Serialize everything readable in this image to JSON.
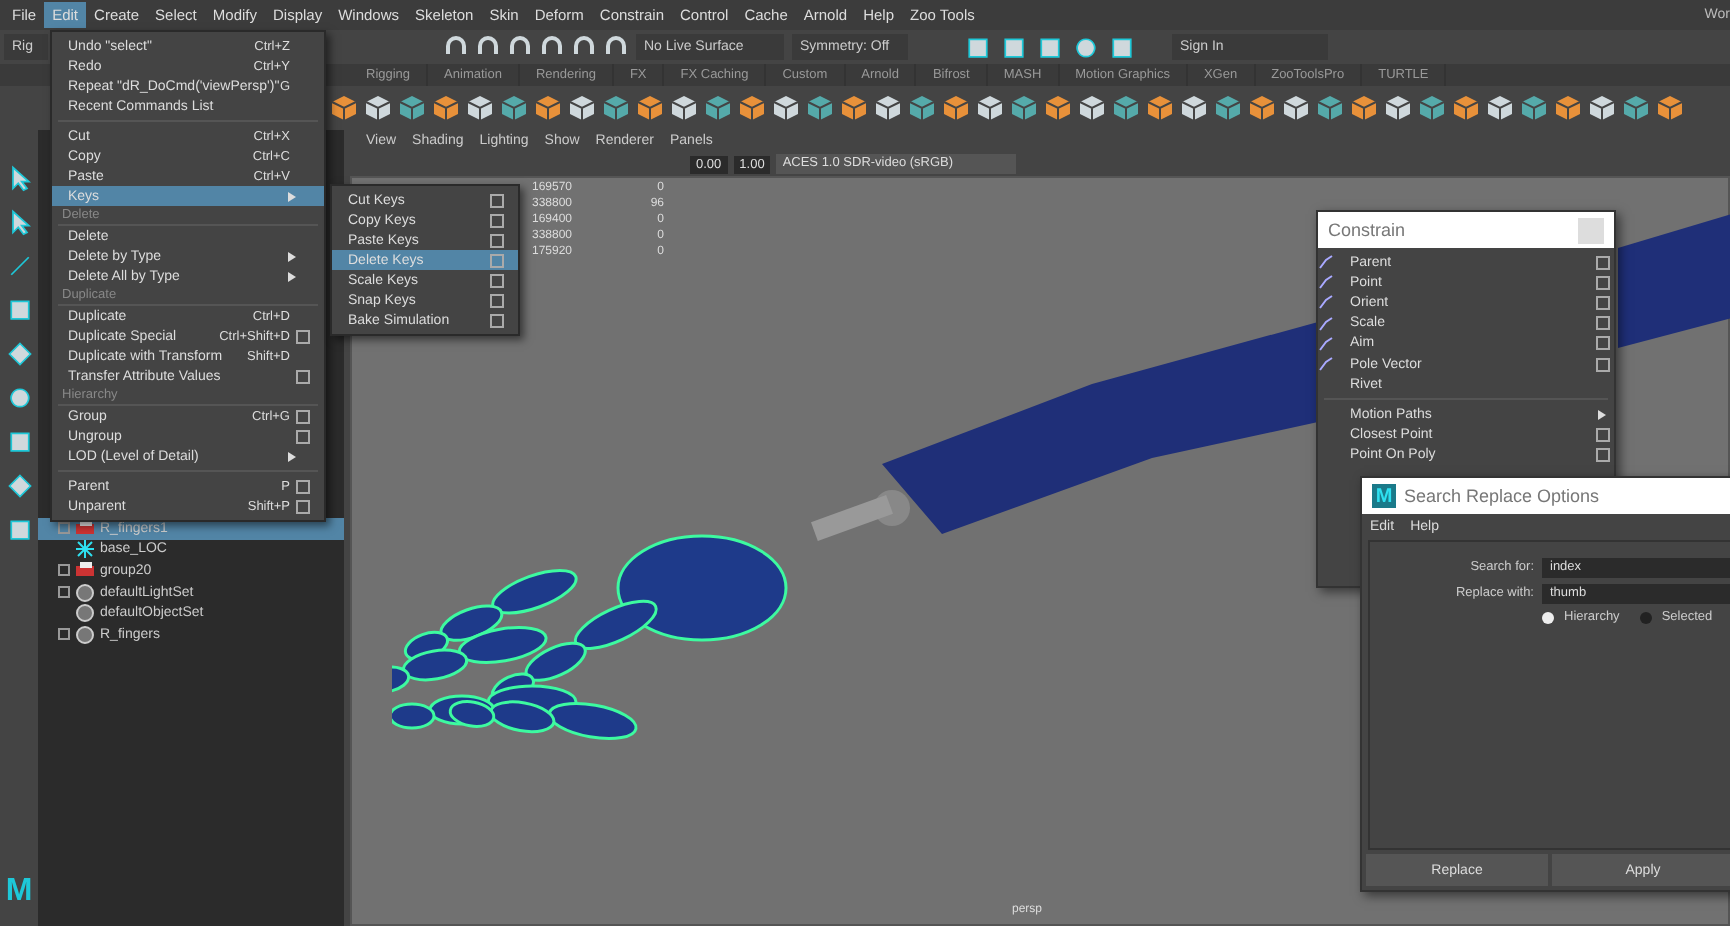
{
  "menu_bar": {
    "items": [
      {
        "label": "File",
        "selected": false
      },
      {
        "label": "Edit",
        "selected": true
      },
      {
        "label": "Create",
        "selected": false
      },
      {
        "label": "Select",
        "selected": false
      },
      {
        "label": "Modify",
        "selected": false
      },
      {
        "label": "Display",
        "selected": false
      },
      {
        "label": "Windows",
        "selected": false
      },
      {
        "label": "Skeleton",
        "selected": false
      },
      {
        "label": "Skin",
        "selected": false
      },
      {
        "label": "Deform",
        "selected": false
      },
      {
        "label": "Constrain",
        "selected": false
      },
      {
        "label": "Control",
        "selected": false
      },
      {
        "label": "Cache",
        "selected": false
      },
      {
        "label": "Arnold",
        "selected": false
      },
      {
        "label": "Help",
        "selected": false
      },
      {
        "label": "Zoo Tools",
        "selected": false
      }
    ],
    "workspace": "Wor"
  },
  "status_line": {
    "mode": "Rig",
    "live_surface": "No Live Surface",
    "symmetry": "Symmetry: Off",
    "sign_in": "Sign In"
  },
  "shelf_tabs": [
    "Rigging",
    "Animation",
    "Rendering",
    "FX",
    "FX Caching",
    "Custom",
    "Arnold",
    "Bifrost",
    "MASH",
    "Motion Graphics",
    "XGen",
    "ZooToolsPro",
    "TURTLE"
  ],
  "logo": "M",
  "outliner": {
    "items": [
      {
        "label": "R_fingers1",
        "kind": "group",
        "expander": true,
        "selected": true
      },
      {
        "label": "base_LOC",
        "kind": "locator",
        "expander": false,
        "selected": false
      },
      {
        "label": "group20",
        "kind": "group",
        "expander": true,
        "selected": false
      },
      {
        "label": "defaultLightSet",
        "kind": "set",
        "expander": true,
        "selected": false
      },
      {
        "label": "defaultObjectSet",
        "kind": "set",
        "expander": false,
        "selected": false
      },
      {
        "label": "R_fingers",
        "kind": "set",
        "expander": true,
        "selected": false
      }
    ]
  },
  "viewport": {
    "menus": [
      "View",
      "Shading",
      "Lighting",
      "Show",
      "Renderer",
      "Panels"
    ],
    "exposure": "0.00",
    "gamma": "1.00",
    "color_space": "ACES 1.0 SDR-video (sRGB)",
    "hud": [
      {
        "value": "169570",
        "count": "0"
      },
      {
        "value": "338800",
        "count": "96"
      },
      {
        "value": "169400",
        "count": "0"
      },
      {
        "value": "338800",
        "count": "0"
      },
      {
        "value": "175920",
        "count": "0"
      }
    ],
    "camera": "persp"
  },
  "edit_menu": {
    "items": [
      {
        "kind": "item",
        "label": "Undo \"select\"",
        "shortcut": "Ctrl+Z",
        "option_box": false,
        "submenu": false,
        "selected": false
      },
      {
        "kind": "item",
        "label": "Redo",
        "shortcut": "Ctrl+Y",
        "option_box": false,
        "submenu": false,
        "selected": false
      },
      {
        "kind": "item",
        "label": "Repeat \"dR_DoCmd('viewPersp')\"",
        "shortcut": "G",
        "option_box": false,
        "submenu": false,
        "selected": false
      },
      {
        "kind": "item",
        "label": "Recent Commands List",
        "option_box": false,
        "submenu": false,
        "selected": false
      },
      {
        "kind": "separator"
      },
      {
        "kind": "item",
        "label": "Cut",
        "shortcut": "Ctrl+X",
        "option_box": false,
        "submenu": false,
        "selected": false
      },
      {
        "kind": "item",
        "label": "Copy",
        "shortcut": "Ctrl+C",
        "option_box": false,
        "submenu": false,
        "selected": false
      },
      {
        "kind": "item",
        "label": "Paste",
        "shortcut": "Ctrl+V",
        "option_box": false,
        "submenu": false,
        "selected": false
      },
      {
        "kind": "item",
        "label": "Keys",
        "option_box": false,
        "submenu": true,
        "selected": true
      },
      {
        "kind": "section",
        "label": "Delete"
      },
      {
        "kind": "item",
        "label": "Delete",
        "option_box": false,
        "submenu": false,
        "selected": false
      },
      {
        "kind": "item",
        "label": "Delete by Type",
        "option_box": false,
        "submenu": true,
        "selected": false
      },
      {
        "kind": "item",
        "label": "Delete All by Type",
        "option_box": false,
        "submenu": true,
        "selected": false
      },
      {
        "kind": "section",
        "label": "Duplicate"
      },
      {
        "kind": "item",
        "label": "Duplicate",
        "shortcut": "Ctrl+D",
        "option_box": false,
        "submenu": false,
        "selected": false
      },
      {
        "kind": "item",
        "label": "Duplicate Special",
        "shortcut": "Ctrl+Shift+D",
        "option_box": true,
        "submenu": false,
        "selected": false
      },
      {
        "kind": "item",
        "label": "Duplicate with Transform",
        "shortcut": "Shift+D",
        "option_box": false,
        "submenu": false,
        "selected": false
      },
      {
        "kind": "item",
        "label": "Transfer Attribute Values",
        "option_box": true,
        "submenu": false,
        "selected": false
      },
      {
        "kind": "section",
        "label": "Hierarchy"
      },
      {
        "kind": "item",
        "label": "Group",
        "shortcut": "Ctrl+G",
        "option_box": true,
        "submenu": false,
        "selected": false
      },
      {
        "kind": "item",
        "label": "Ungroup",
        "option_box": true,
        "submenu": false,
        "selected": false
      },
      {
        "kind": "item",
        "label": "LOD (Level of Detail)",
        "option_box": false,
        "submenu": true,
        "selected": false
      },
      {
        "kind": "separator"
      },
      {
        "kind": "item",
        "label": "Parent",
        "shortcut": "P",
        "option_box": true,
        "submenu": false,
        "selected": false
      },
      {
        "kind": "item",
        "label": "Unparent",
        "shortcut": "Shift+P",
        "option_box": true,
        "submenu": false,
        "selected": false
      }
    ]
  },
  "keys_submenu": {
    "items": [
      {
        "label": "Cut Keys",
        "selected": false
      },
      {
        "label": "Copy Keys",
        "selected": false
      },
      {
        "label": "Paste Keys",
        "selected": false
      },
      {
        "label": "Delete Keys",
        "selected": true
      },
      {
        "label": "Scale Keys",
        "selected": false
      },
      {
        "label": "Snap Keys",
        "selected": false
      },
      {
        "label": "Bake Simulation",
        "selected": false
      }
    ]
  },
  "constrain_window": {
    "title": "Constrain",
    "items": [
      {
        "kind": "constraint",
        "label": "Parent",
        "option_box": true,
        "submenu": false
      },
      {
        "kind": "constraint",
        "label": "Point",
        "option_box": true,
        "submenu": false
      },
      {
        "kind": "constraint",
        "label": "Orient",
        "option_box": true,
        "submenu": false
      },
      {
        "kind": "constraint",
        "label": "Scale",
        "option_box": true,
        "submenu": false
      },
      {
        "kind": "constraint",
        "label": "Aim",
        "option_box": true,
        "submenu": false
      },
      {
        "kind": "constraint",
        "label": "Pole Vector",
        "option_box": true,
        "submenu": false
      },
      {
        "kind": "item",
        "label": "Rivet",
        "option_box": false,
        "submenu": false
      },
      {
        "kind": "separator"
      },
      {
        "kind": "item",
        "label": "Motion Paths",
        "option_box": false,
        "submenu": true
      },
      {
        "kind": "item",
        "label": "Closest Point",
        "option_box": true,
        "submenu": false
      },
      {
        "kind": "item",
        "label": "Point On Poly",
        "option_box": true,
        "submenu": false
      }
    ]
  },
  "search_replace": {
    "title": "Search Replace Options",
    "logo": "M",
    "menus": [
      "Edit",
      "Help"
    ],
    "search_label": "Search for:",
    "search_value": "index",
    "replace_label": "Replace with:",
    "replace_value": "thumb",
    "scope": [
      {
        "label": "Hierarchy",
        "selected": true
      },
      {
        "label": "Selected",
        "selected": false
      }
    ],
    "buttons": [
      "Replace",
      "Apply"
    ]
  }
}
